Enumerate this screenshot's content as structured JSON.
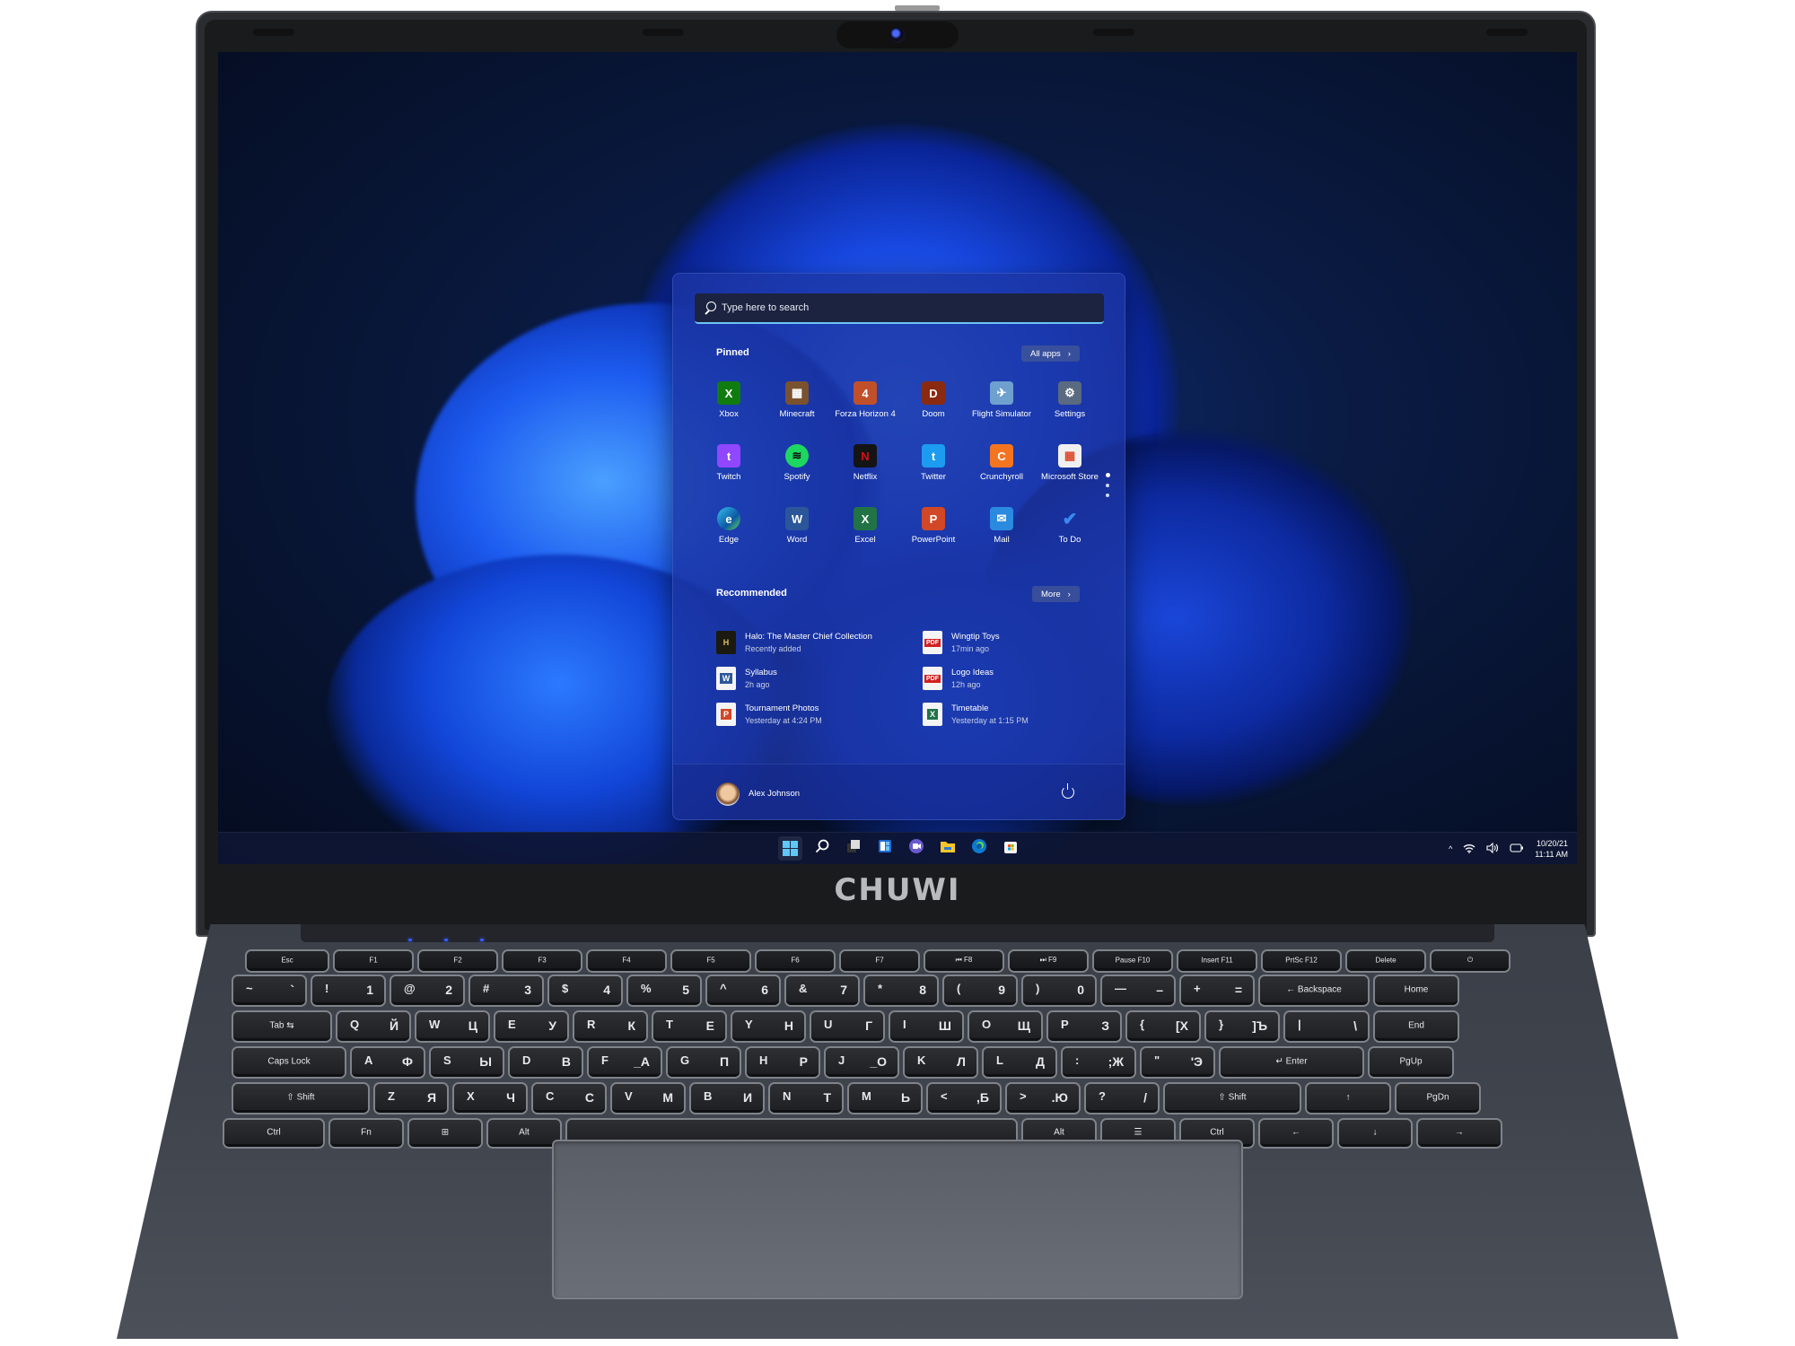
{
  "device": {
    "brand": "CHUWI"
  },
  "start_menu": {
    "search_placeholder": "Type here to search",
    "pinned_title": "Pinned",
    "all_apps_label": "All apps",
    "pinned_apps": [
      {
        "label": "Xbox",
        "icon": "xbox-icon",
        "color": "#107c10",
        "glyph": "X"
      },
      {
        "label": "Minecraft",
        "icon": "minecraft-icon",
        "color": "#7a5230",
        "glyph": "▦"
      },
      {
        "label": "Forza Horizon 4",
        "icon": "forza-horizon-icon",
        "color": "#c0502a",
        "glyph": "4"
      },
      {
        "label": "Doom",
        "icon": "doom-icon",
        "color": "#8a2a10",
        "glyph": "D"
      },
      {
        "label": "Flight Simulator",
        "icon": "flight-simulator-icon",
        "color": "#6ea0d0",
        "glyph": "✈"
      },
      {
        "label": "Settings",
        "icon": "gear-icon",
        "color": "#5a6a80",
        "glyph": "⚙"
      },
      {
        "label": "Twitch",
        "icon": "twitch-icon",
        "color": "#9146ff",
        "glyph": "t"
      },
      {
        "label": "Spotify",
        "icon": "spotify-icon",
        "color": "#1ed760",
        "glyph": "≋"
      },
      {
        "label": "Netflix",
        "icon": "netflix-icon",
        "color": "#141414",
        "glyph": "N"
      },
      {
        "label": "Twitter",
        "icon": "twitter-icon",
        "color": "#1d9bf0",
        "glyph": "t"
      },
      {
        "label": "Crunchyroll",
        "icon": "crunchyroll-icon",
        "color": "#f47521",
        "glyph": "C"
      },
      {
        "label": "Microsoft Store",
        "icon": "store-icon",
        "color": "#f0f0f0",
        "glyph": "▦"
      },
      {
        "label": "Edge",
        "icon": "edge-icon",
        "color": "#0c7bd0",
        "glyph": "e"
      },
      {
        "label": "Word",
        "icon": "word-icon",
        "color": "#2b579a",
        "glyph": "W"
      },
      {
        "label": "Excel",
        "icon": "excel-icon",
        "color": "#217346",
        "glyph": "X"
      },
      {
        "label": "PowerPoint",
        "icon": "powerpoint-icon",
        "color": "#d24726",
        "glyph": "P"
      },
      {
        "label": "Mail",
        "icon": "mail-icon",
        "color": "#2a8ae0",
        "glyph": "✉"
      },
      {
        "label": "To Do",
        "icon": "todo-icon",
        "color": "transparent",
        "glyph": "✔"
      }
    ],
    "recommended_title": "Recommended",
    "more_label": "More",
    "recommended": [
      {
        "name": "Halo: The Master Chief Collection",
        "time": "Recently added",
        "icon": "halo-icon",
        "color": "#2a2a1a",
        "glyph": "H"
      },
      {
        "name": "Wingtip Toys",
        "time": "17min ago",
        "icon": "pdf-icon",
        "color": "#d21f1f",
        "glyph": "PDF"
      },
      {
        "name": "Syllabus",
        "time": "2h ago",
        "icon": "word-doc-icon",
        "color": "#2b579a",
        "glyph": "W"
      },
      {
        "name": "Logo Ideas",
        "time": "12h ago",
        "icon": "pdf-icon",
        "color": "#d21f1f",
        "glyph": "PDF"
      },
      {
        "name": "Tournament Photos",
        "time": "Yesterday at 4:24 PM",
        "icon": "powerpoint-doc-icon",
        "color": "#d24726",
        "glyph": "P"
      },
      {
        "name": "Timetable",
        "time": "Yesterday at 1:15 PM",
        "icon": "excel-doc-icon",
        "color": "#217346",
        "glyph": "X"
      }
    ],
    "user_name": "Alex Johnson"
  },
  "taskbar": {
    "items": [
      {
        "name": "start-button",
        "icon": "windows-icon"
      },
      {
        "name": "search-button",
        "icon": "search-icon"
      },
      {
        "name": "task-view-button",
        "icon": "task-view-icon"
      },
      {
        "name": "widgets-button",
        "icon": "widgets-icon"
      },
      {
        "name": "chat-button",
        "icon": "teams-chat-icon"
      },
      {
        "name": "file-explorer-button",
        "icon": "folder-icon"
      },
      {
        "name": "edge-button",
        "icon": "edge-icon"
      },
      {
        "name": "store-button",
        "icon": "store-icon"
      }
    ],
    "tray": {
      "chevron": "^",
      "date": "10/20/21",
      "time": "11:11 AM"
    }
  },
  "keyboard": {
    "function_row": [
      {
        "top": "Esc",
        "bottom": ""
      },
      {
        "top": "",
        "bottom": "F1"
      },
      {
        "top": "",
        "bottom": "F2"
      },
      {
        "top": "",
        "bottom": "F3"
      },
      {
        "top": "",
        "bottom": "F4"
      },
      {
        "top": "",
        "bottom": "F5"
      },
      {
        "top": "",
        "bottom": "F6"
      },
      {
        "top": "",
        "bottom": "F7"
      },
      {
        "top": "⏮",
        "bottom": "F8"
      },
      {
        "top": "⏭",
        "bottom": "F9"
      },
      {
        "top": "Pause",
        "bottom": "F10"
      },
      {
        "top": "Insert",
        "bottom": "F11"
      },
      {
        "top": "PrtSc",
        "bottom": "F12"
      },
      {
        "top": "Delete",
        "bottom": ""
      },
      {
        "top": "⏻",
        "bottom": ""
      }
    ],
    "number_row": [
      {
        "p": "~",
        "s": "`"
      },
      {
        "p": "!",
        "s": "1"
      },
      {
        "p": "@",
        "s": "2"
      },
      {
        "p": "#",
        "s": "3"
      },
      {
        "p": "$",
        "s": "4"
      },
      {
        "p": "%",
        "s": "5"
      },
      {
        "p": "^",
        "s": "6"
      },
      {
        "p": "&",
        "s": "7"
      },
      {
        "p": "*",
        "s": "8"
      },
      {
        "p": "(",
        "s": "9"
      },
      {
        "p": ")",
        "s": "0"
      },
      {
        "p": "—",
        "s": "–"
      },
      {
        "p": "+",
        "s": "="
      },
      {
        "c": "← Backspace"
      },
      {
        "c": "Home"
      }
    ],
    "qwerty_row": [
      {
        "c": "Tab ⇆"
      },
      {
        "p": "Q",
        "s": "Й"
      },
      {
        "p": "W",
        "s": "Ц"
      },
      {
        "p": "E",
        "s": "У"
      },
      {
        "p": "R",
        "s": "К"
      },
      {
        "p": "T",
        "s": "Е"
      },
      {
        "p": "Y",
        "s": "Н"
      },
      {
        "p": "U",
        "s": "Г"
      },
      {
        "p": "I",
        "s": "Ш"
      },
      {
        "p": "O",
        "s": "Щ"
      },
      {
        "p": "P",
        "s": "З"
      },
      {
        "p": "{",
        "s": "[Х"
      },
      {
        "p": "}",
        "s": "]Ъ"
      },
      {
        "p": "|",
        "s": "\\"
      },
      {
        "c": "End"
      }
    ],
    "home_row": [
      {
        "c": "Caps Lock"
      },
      {
        "p": "A",
        "s": "Ф"
      },
      {
        "p": "S",
        "s": "Ы"
      },
      {
        "p": "D",
        "s": "В"
      },
      {
        "p": "F",
        "s": "_А"
      },
      {
        "p": "G",
        "s": "П"
      },
      {
        "p": "H",
        "s": "Р"
      },
      {
        "p": "J",
        "s": "_О"
      },
      {
        "p": "K",
        "s": "Л"
      },
      {
        "p": "L",
        "s": "Д"
      },
      {
        "p": ":",
        "s": ";Ж"
      },
      {
        "p": "\"",
        "s": "'Э"
      },
      {
        "c": "↵ Enter"
      },
      {
        "c": "PgUp"
      }
    ],
    "shift_row": [
      {
        "c": "⇧ Shift"
      },
      {
        "p": "Z",
        "s": "Я"
      },
      {
        "p": "X",
        "s": "Ч"
      },
      {
        "p": "C",
        "s": "С"
      },
      {
        "p": "V",
        "s": "М"
      },
      {
        "p": "B",
        "s": "И"
      },
      {
        "p": "N",
        "s": "Т"
      },
      {
        "p": "M",
        "s": "Ь"
      },
      {
        "p": "<",
        "s": ",Б"
      },
      {
        "p": ">",
        "s": ".Ю"
      },
      {
        "p": "?",
        "s": "/"
      },
      {
        "c": "⇧ Shift"
      },
      {
        "c": "↑"
      },
      {
        "c": "PgDn"
      }
    ],
    "bottom_row": [
      {
        "c": "Ctrl"
      },
      {
        "c": "Fn"
      },
      {
        "c": "⊞"
      },
      {
        "c": "Alt"
      },
      {
        "c": ""
      },
      {
        "c": "Alt"
      },
      {
        "c": "☰"
      },
      {
        "c": "Ctrl"
      },
      {
        "c": "←"
      },
      {
        "c": "↓"
      },
      {
        "c": "→"
      }
    ]
  }
}
